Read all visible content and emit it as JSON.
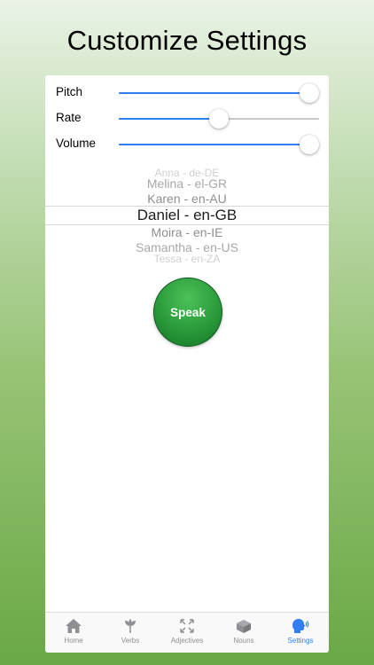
{
  "headline": "Customize Settings",
  "sliders": {
    "pitch": {
      "label": "Pitch",
      "value": 0.95
    },
    "rate": {
      "label": "Rate",
      "value": 0.5
    },
    "volume": {
      "label": "Volume",
      "value": 0.95
    }
  },
  "voice_picker": {
    "items": [
      "Anna - de-DE",
      "Melina - el-GR",
      "Karen - en-AU",
      "Daniel - en-GB",
      "Moira - en-IE",
      "Samantha - en-US",
      "Tessa - en-ZA"
    ],
    "selected": "Daniel - en-GB"
  },
  "speak_label": "Speak",
  "tabs": [
    {
      "label": "Home",
      "icon": "home-icon"
    },
    {
      "label": "Verbs",
      "icon": "plant-icon"
    },
    {
      "label": "Adjectives",
      "icon": "expand-arrows-icon"
    },
    {
      "label": "Nouns",
      "icon": "box-icon"
    },
    {
      "label": "Settings",
      "icon": "speaking-head-icon",
      "active": true
    }
  ],
  "colors": {
    "accent": "#2f7ef5",
    "speak_button": "#2a9a3a"
  }
}
